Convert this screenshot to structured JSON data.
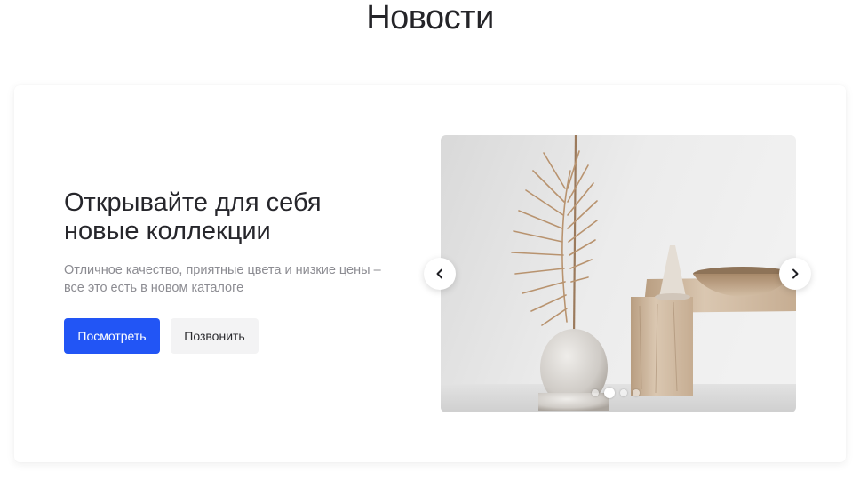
{
  "page": {
    "title": "Новости"
  },
  "promo": {
    "heading_line1": "Открывайте для себя",
    "heading_line2": "новые коллекции",
    "text_line1": "Отличное качество, приятные цвета и низкие цены –",
    "text_line2": "все это есть в новом каталоге",
    "primary_button": "Посмотреть",
    "secondary_button": "Позвонить"
  },
  "slider": {
    "slide_count": 4,
    "active_slide": 2,
    "image": "dried-palm-leaf-vase-wooden-bench",
    "prev_icon": "chevron-left-icon",
    "next_icon": "chevron-right-icon"
  },
  "colors": {
    "accent": "#2255f5",
    "secondary_button_bg": "#f3f3f4",
    "text_muted": "#8c8c92"
  }
}
